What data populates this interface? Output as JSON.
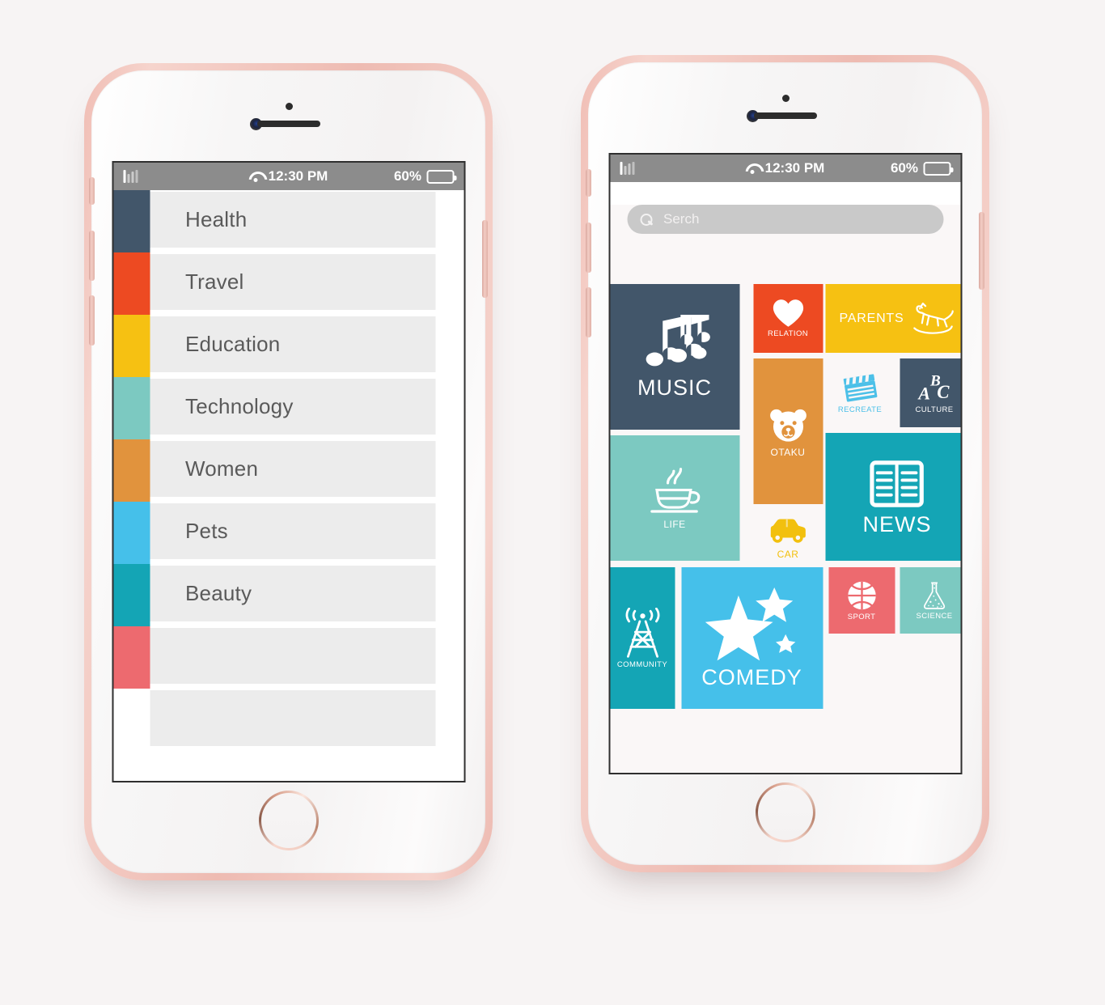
{
  "statusbar": {
    "time": "12:30 PM",
    "battery_percent": "60%",
    "signal_icon": "signal-bars-icon",
    "wifi_icon": "wifi-icon",
    "battery_icon": "battery-icon"
  },
  "left_phone": {
    "screen_name": "category-list",
    "rows": [
      {
        "label": "Health",
        "color": "#42566a"
      },
      {
        "label": "Travel",
        "color": "#ed4a22"
      },
      {
        "label": "Education",
        "color": "#f6c112"
      },
      {
        "label": "Technology",
        "color": "#7cc9c1"
      },
      {
        "label": "Women",
        "color": "#e1933d"
      },
      {
        "label": "Pets",
        "color": "#45c0ea"
      },
      {
        "label": "Beauty",
        "color": "#14a5b5"
      },
      {
        "label": "",
        "color": "#ed6a6f"
      },
      {
        "label": "",
        "color": "#ffffff"
      }
    ]
  },
  "right_phone": {
    "screen_name": "category-tiles",
    "search": {
      "placeholder": "Serch",
      "value": "",
      "icon": "search-icon"
    },
    "tiles": [
      {
        "label": "MUSIC",
        "icon": "music-notes-icon",
        "bg": "#42566a",
        "fg": "#ffffff"
      },
      {
        "label": "RELATION",
        "icon": "heart-icon",
        "bg": "#ed4a22",
        "fg": "#ffffff"
      },
      {
        "label": "PARENTS",
        "icon": "rocking-horse-icon",
        "bg": "#f6c112",
        "fg": "#ffffff"
      },
      {
        "label": "OTAKU",
        "icon": "bear-face-icon",
        "bg": "#e1933d",
        "fg": "#ffffff"
      },
      {
        "label": "RECREATE",
        "icon": "clapperboard-icon",
        "bg": "transparent",
        "fg": "#4cc0e8"
      },
      {
        "label": "CULTURE",
        "icon": "abc-icon",
        "bg": "#42566a",
        "fg": "#ffffff"
      },
      {
        "label": "LIFE",
        "icon": "coffee-cup-icon",
        "bg": "#7cc9c1",
        "fg": "#ffffff"
      },
      {
        "label": "CAR",
        "icon": "car-icon",
        "bg": "transparent",
        "fg": "#f2c00e"
      },
      {
        "label": "NEWS",
        "icon": "open-book-icon",
        "bg": "#14a5b5",
        "fg": "#ffffff"
      },
      {
        "label": "COMMUNITY",
        "icon": "radio-tower-icon",
        "bg": "#14a5b5",
        "fg": "#ffffff"
      },
      {
        "label": "COMEDY",
        "icon": "stars-icon",
        "bg": "#45c0ea",
        "fg": "#ffffff"
      },
      {
        "label": "SPORT",
        "icon": "basketball-icon",
        "bg": "#ed6a6f",
        "fg": "#ffffff"
      },
      {
        "label": "SCIENCE",
        "icon": "flask-icon",
        "bg": "#7cc9c1",
        "fg": "#ffffff"
      }
    ]
  },
  "hardware": {
    "home_button": "home-button",
    "speaker": "earpiece-speaker",
    "camera": "front-camera",
    "sensor": "proximity-sensor",
    "volume_up": "volume-up-button",
    "volume_down": "volume-down-button",
    "mute_switch": "mute-switch",
    "power_button": "power-button"
  }
}
